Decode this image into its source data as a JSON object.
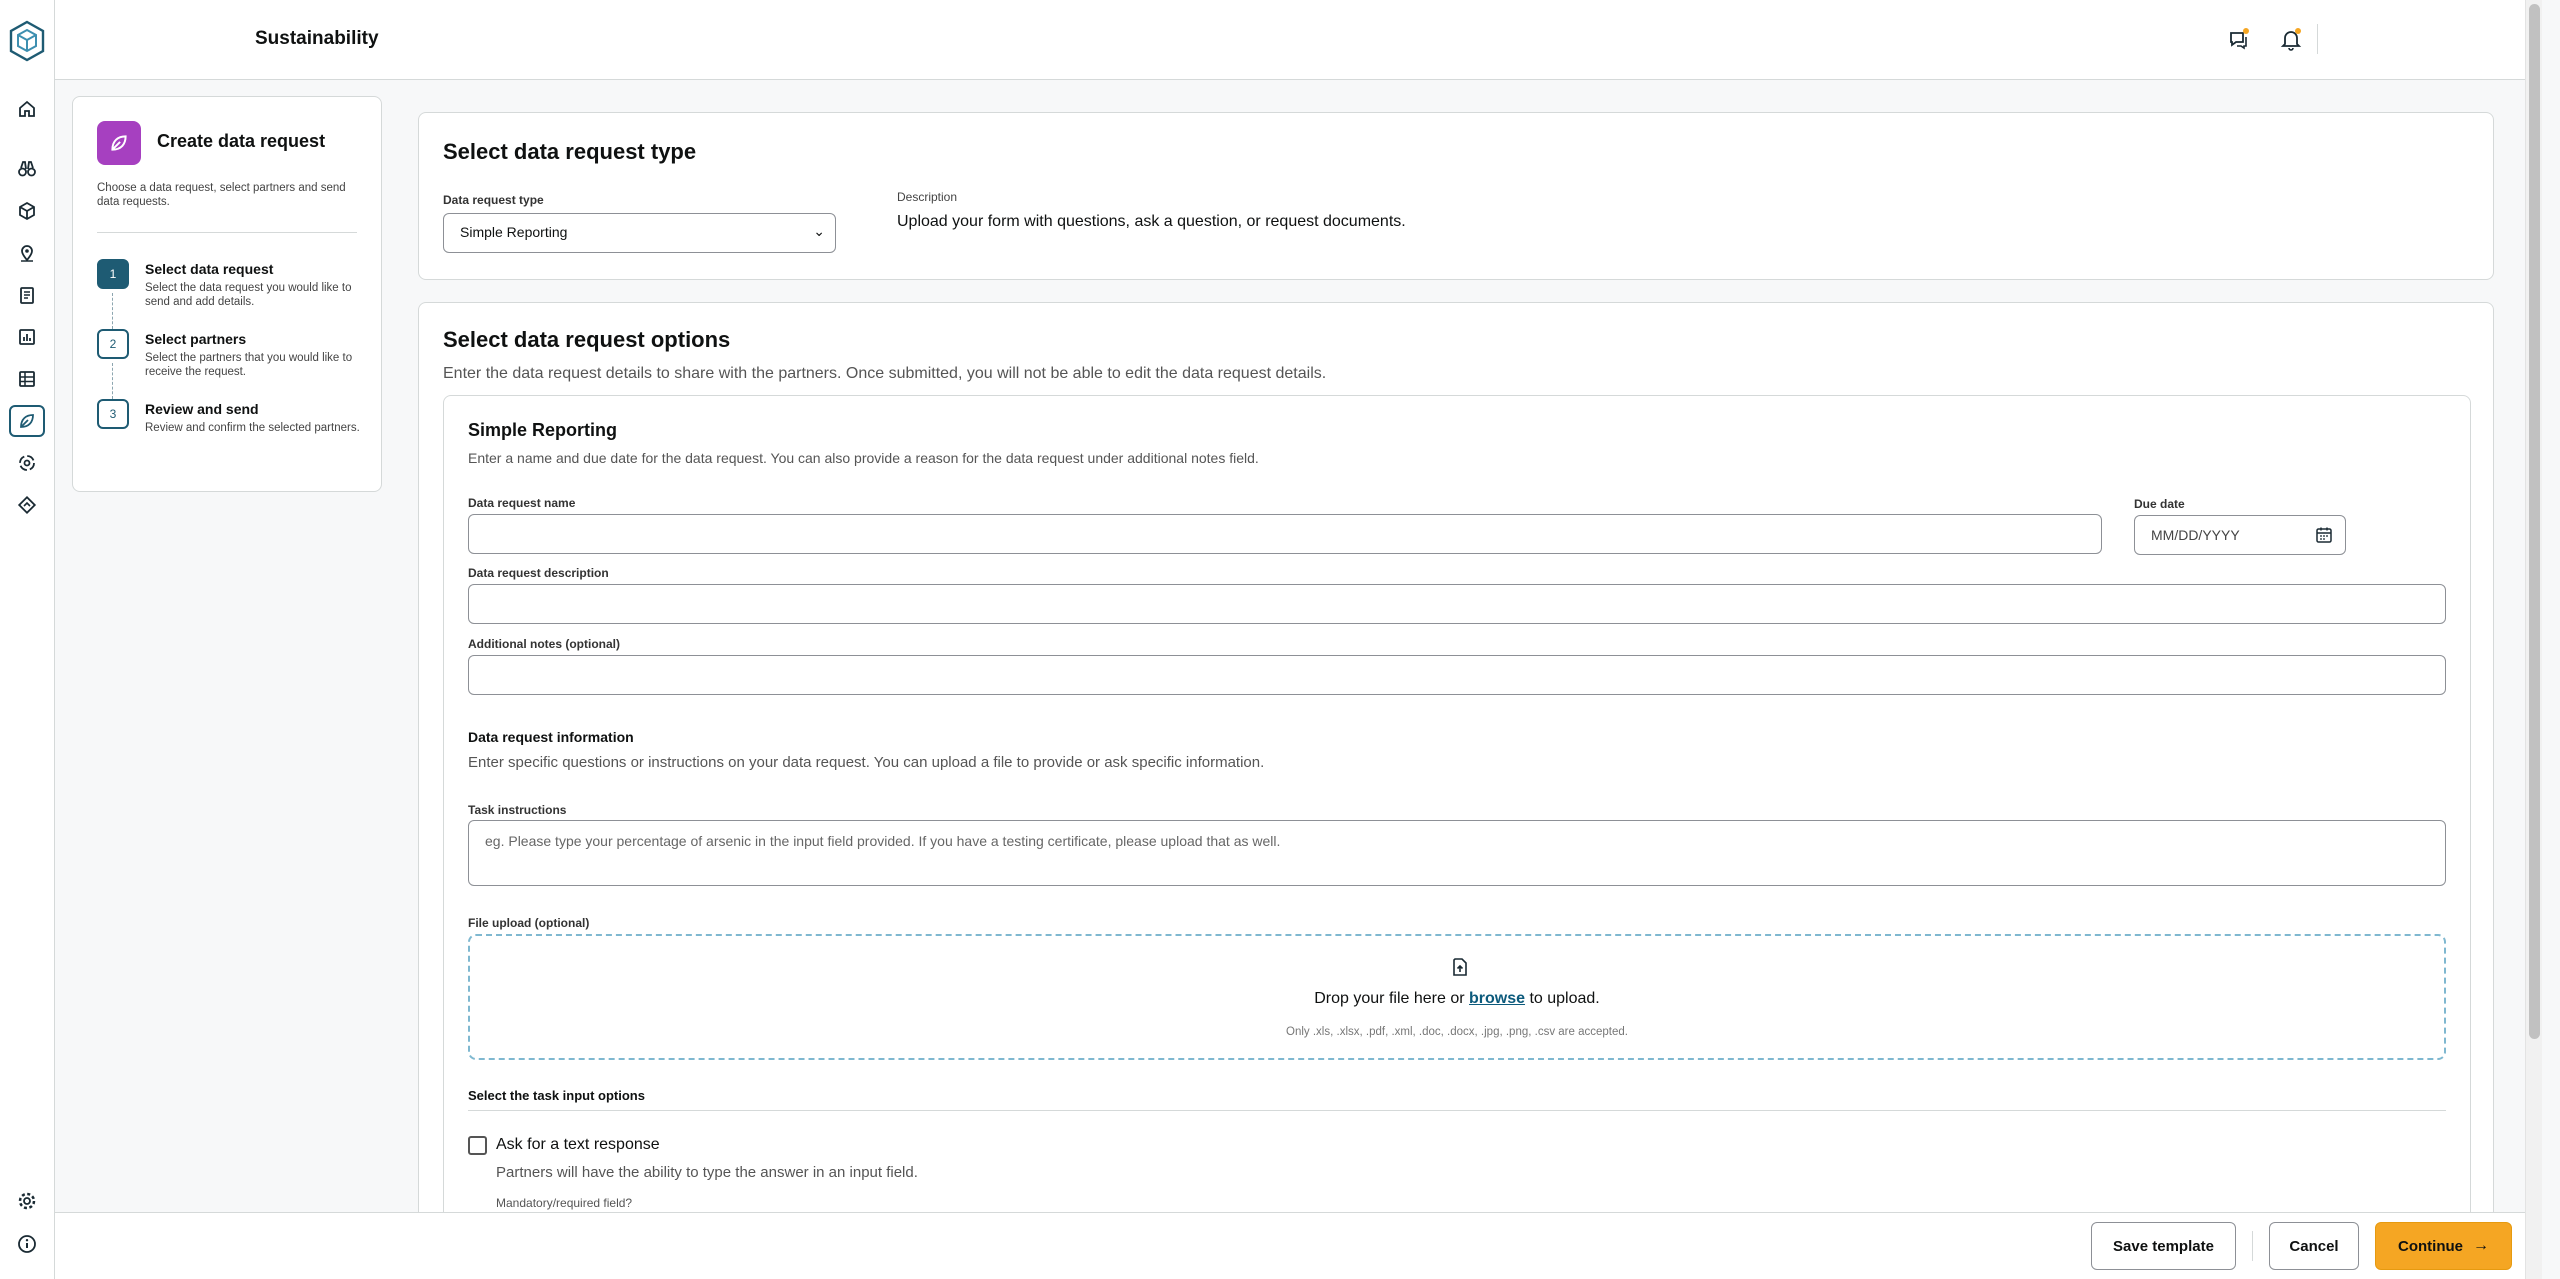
{
  "header": {
    "title": "Sustainability"
  },
  "steps_panel": {
    "title": "Create data request",
    "subtitle": "Choose a data request, select partners and send data requests.",
    "steps": [
      {
        "number": "1",
        "label": "Select data request",
        "desc": "Select the data request you would like to send and add details.",
        "active": true
      },
      {
        "number": "2",
        "label": "Select partners",
        "desc": "Select the partners that you would like to receive the request.",
        "active": false
      },
      {
        "number": "3",
        "label": "Review and send",
        "desc": "Review and confirm the selected partners.",
        "active": false
      }
    ]
  },
  "type_section": {
    "title": "Select data request type",
    "type_label": "Data request type",
    "type_value": "Simple Reporting",
    "description_label": "Description",
    "description": "Upload your form with questions, ask a question, or request documents."
  },
  "options_section": {
    "title": "Select data request options",
    "subtitle": "Enter the data request details to share with the partners. Once submitted, you will not be able to edit the data request details.",
    "form": {
      "title": "Simple Reporting",
      "subtitle": "Enter a name and due date for the data request. You can also provide a reason for the data request under additional notes field.",
      "name_label": "Data request name",
      "due_label": "Due date",
      "due_placeholder": "MM/DD/YYYY",
      "description_label": "Data request description",
      "notes_label": "Additional notes (optional)",
      "info_title": "Data request information",
      "info_subtitle": "Enter specific questions or instructions on your data request. You can upload a file to provide or ask specific information.",
      "task_label": "Task instructions",
      "task_placeholder": "eg. Please type your percentage of arsenic in the input field provided. If you have a testing certificate, please upload that as well.",
      "upload_label": "File upload (optional)",
      "upload_text_before": "Drop your file here or",
      "upload_browse": "browse",
      "upload_text_after": "to upload.",
      "upload_accept": "Only .xls, .xlsx, .pdf, .xml, .doc, .docx, .jpg, .png, .csv are accepted.",
      "task_options_title": "Select the task input options",
      "text_response_label": "Ask for a text response",
      "text_response_desc": "Partners will have the ability to type the answer in an input field.",
      "mandatory_label": "Mandatory/required field?"
    }
  },
  "footer": {
    "save_template": "Save template",
    "cancel": "Cancel",
    "continue": "Continue"
  },
  "colors": {
    "accent": "#1e5b73",
    "primary_button": "#f5a623",
    "badge": "#a640c0"
  }
}
